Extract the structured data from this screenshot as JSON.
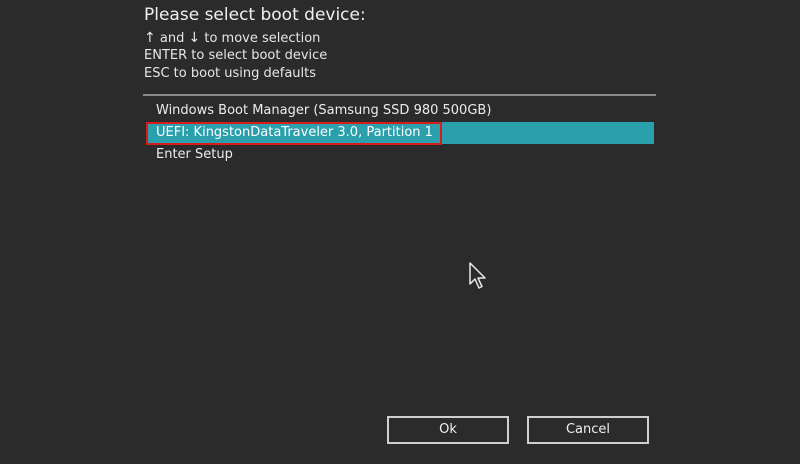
{
  "title": "Please select boot device:",
  "hints": {
    "move": {
      "up_arrow": "↑",
      "and": "and",
      "down_arrow": "↓",
      "text": "to move selection"
    },
    "select": "ENTER to select boot device",
    "defaults": "ESC to boot using defaults"
  },
  "devices": [
    {
      "label": "Windows Boot Manager (Samsung SSD 980 500GB)",
      "selected": false
    },
    {
      "label": "UEFI: KingstonDataTraveler 3.0, Partition 1",
      "selected": true
    },
    {
      "label": "Enter Setup",
      "selected": false
    }
  ],
  "buttons": {
    "ok": "Ok",
    "cancel": "Cancel"
  },
  "colors": {
    "background": "#2b2b2b",
    "selection": "#2aa0ad",
    "highlight_border": "#d81c1c"
  },
  "icons": {
    "cursor": "mouse-pointer-icon"
  }
}
